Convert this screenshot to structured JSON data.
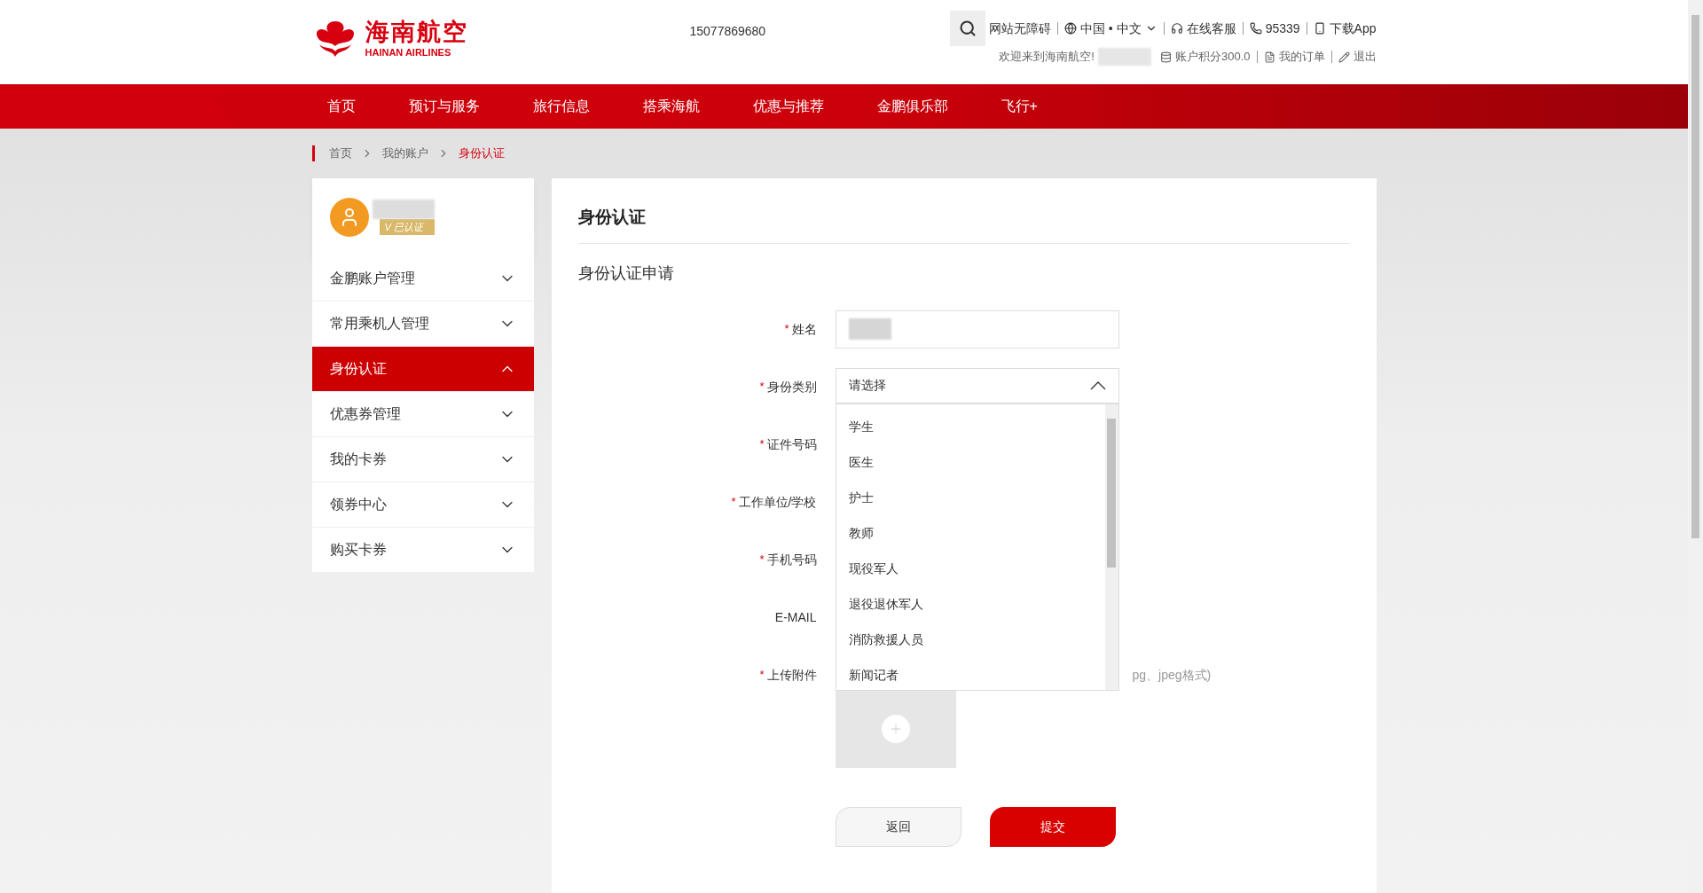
{
  "header": {
    "logo": {
      "name": "海南航空",
      "subtitle": "HAINAN AIRLINES"
    },
    "phone": "15077869680",
    "utility_links": [
      {
        "kind": "accessibility",
        "label": "网站无障碍"
      },
      {
        "kind": "language",
        "label": "中国 • 中文"
      },
      {
        "kind": "service",
        "label": "在线客服"
      },
      {
        "kind": "hotline",
        "label": "95339"
      },
      {
        "kind": "app",
        "label": "下载App"
      }
    ],
    "welcome": "欢迎来到海南航空!",
    "account_links": [
      {
        "kind": "points",
        "label": "账户积分300.0"
      },
      {
        "kind": "orders",
        "label": "我的订单"
      },
      {
        "kind": "logout",
        "label": "退出"
      }
    ]
  },
  "nav": [
    "首页",
    "预订与服务",
    "旅行信息",
    "搭乘海航",
    "优惠与推荐",
    "金鹏俱乐部",
    "飞行+"
  ],
  "breadcrumb": [
    {
      "label": "首页",
      "current": false
    },
    {
      "label": "我的账户",
      "current": false
    },
    {
      "label": "身份认证",
      "current": true
    }
  ],
  "sidebar": {
    "user": {
      "badge": "V 已认证"
    },
    "items": [
      {
        "label": "金鹏账户管理",
        "selected": false
      },
      {
        "label": "常用乘机人管理",
        "selected": false
      },
      {
        "label": "身份认证",
        "selected": true
      },
      {
        "label": "优惠券管理",
        "selected": false
      },
      {
        "label": "我的卡券",
        "selected": false
      },
      {
        "label": "领券中心",
        "selected": false
      },
      {
        "label": "购买卡券",
        "selected": false
      }
    ]
  },
  "form": {
    "title": "身份认证",
    "subtitle": "身份认证申请",
    "required_mark": "*",
    "fields": [
      {
        "label": "姓名",
        "required": true,
        "kind": "text"
      },
      {
        "label": "身份类别",
        "required": true,
        "kind": "select",
        "placeholder": "请选择",
        "expanded": true,
        "options": [
          "学生",
          "医生",
          "护士",
          "教师",
          "现役军人",
          "退役退休军人",
          "消防救援人员",
          "新闻记者"
        ]
      },
      {
        "label": "证件号码",
        "required": true,
        "kind": "covered"
      },
      {
        "label": "工作单位/学校",
        "required": true,
        "kind": "covered"
      },
      {
        "label": "手机号码",
        "required": true,
        "kind": "covered"
      },
      {
        "label": "E-MAIL",
        "required": false,
        "kind": "covered"
      },
      {
        "label": "上传附件",
        "required": true,
        "kind": "upload",
        "hint": "pg、jpeg格式)"
      }
    ],
    "buttons": [
      {
        "label": "返回",
        "kind": "secondary"
      },
      {
        "label": "提交",
        "kind": "primary"
      }
    ]
  }
}
